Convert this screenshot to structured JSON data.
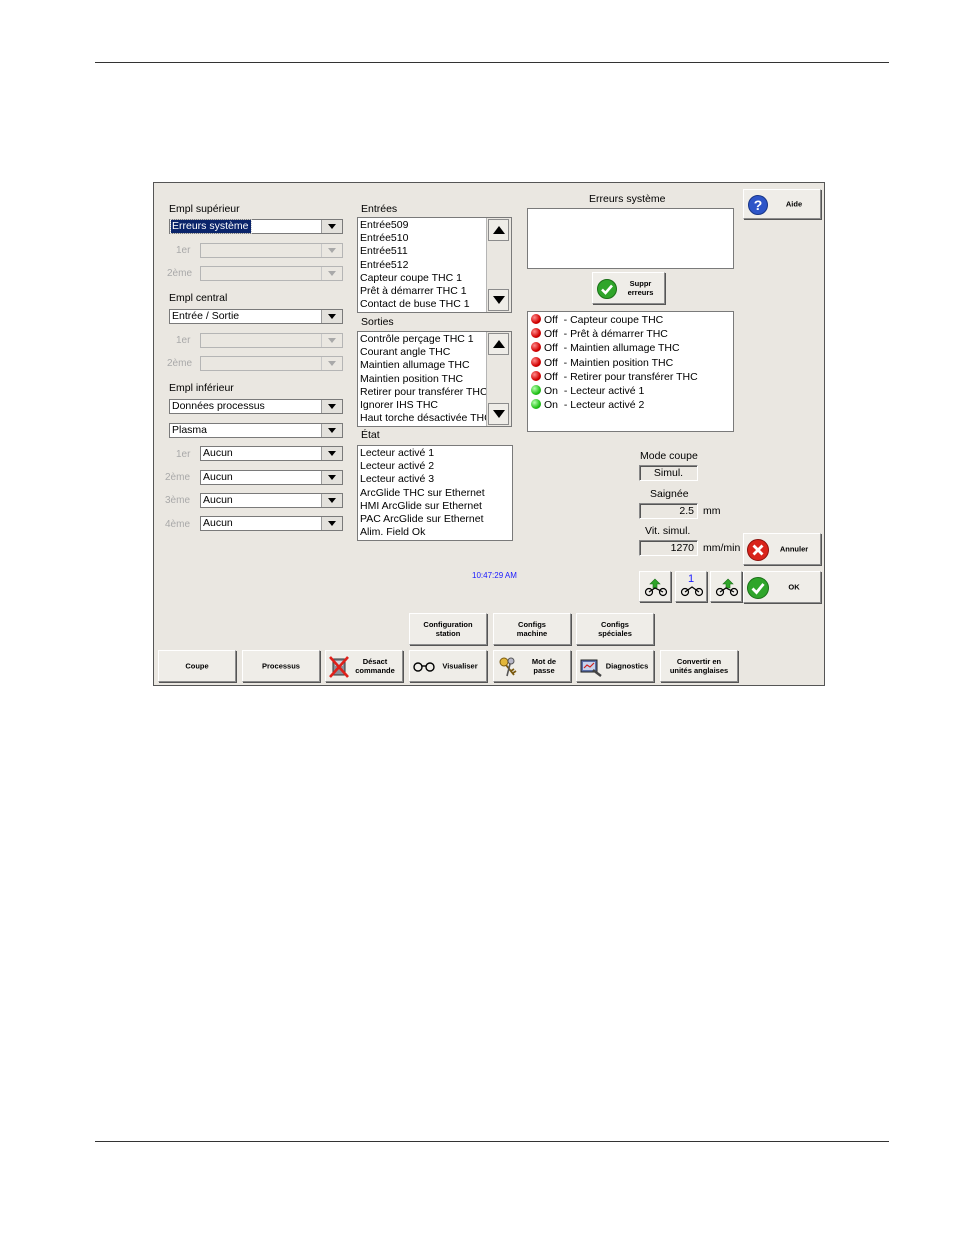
{
  "left": {
    "upper": {
      "title": "Empl supérieur",
      "value": "Erreurs système",
      "slot1_label": "1er",
      "slot2_label": "2ème"
    },
    "central": {
      "title": "Empl central",
      "value": "Entrée / Sortie",
      "slot1_label": "1er",
      "slot2_label": "2ème"
    },
    "lower": {
      "title": "Empl inférieur",
      "value": "Données processus",
      "process": "Plasma",
      "slots": [
        {
          "label": "1er",
          "value": "Aucun"
        },
        {
          "label": "2ème",
          "value": "Aucun"
        },
        {
          "label": "3ème",
          "value": "Aucun"
        },
        {
          "label": "4ème",
          "value": "Aucun"
        }
      ]
    }
  },
  "entrees": {
    "title": "Entrées",
    "items": [
      "Entrée509",
      "Entrée510",
      "Entrée511",
      "Entrée512",
      "Capteur coupe THC 1",
      "Prêt à démarrer THC 1",
      "Contact de buse THC 1"
    ]
  },
  "sorties": {
    "title": "Sorties",
    "items": [
      "Contrôle perçage THC 1",
      "Courant angle THC",
      "Maintien allumage THC",
      "Maintien position THC",
      "Retirer pour transférer THC",
      "Ignorer IHS THC",
      "Haut torche désactivée THC"
    ]
  },
  "etat": {
    "title": "État",
    "items": [
      "Lecteur activé 1",
      "Lecteur activé 2",
      "Lecteur activé 3",
      "ArcGlide THC sur Ethernet",
      "HMI ArcGlide sur Ethernet",
      "PAC ArcGlide sur Ethernet",
      "Alim. Field Ok"
    ]
  },
  "errors": {
    "title": "Erreurs système",
    "clear_button": "Suppr\nerreurs"
  },
  "help_button": "Aide",
  "status": [
    {
      "state": "Off",
      "label": "Capteur coupe THC",
      "color": "red"
    },
    {
      "state": "Off",
      "label": "Prêt à démarrer THC",
      "color": "red"
    },
    {
      "state": "Off",
      "label": "Maintien allumage THC",
      "color": "red"
    },
    {
      "state": "Off",
      "label": "Maintien position THC",
      "color": "red"
    },
    {
      "state": "Off",
      "label": "Retirer pour transférer THC",
      "color": "red"
    },
    {
      "state": "On",
      "label": "Lecteur activé 1",
      "color": "green"
    },
    {
      "state": "On",
      "label": "Lecteur activé 2",
      "color": "green"
    }
  ],
  "mode": {
    "title": "Mode coupe",
    "value": "Simul."
  },
  "kerf": {
    "title": "Saignée",
    "value": "2.5",
    "unit": "mm"
  },
  "speed": {
    "title": "Vit. simul.",
    "value": "1270",
    "unit": "mm/min"
  },
  "time": "10:47:29 AM",
  "cancel_button": "Annuler",
  "ok_button": "OK",
  "stepper_label": "1",
  "top_buttons": [
    "Configuration\nstation",
    "Configs\nmachine",
    "Configs\nspéciales"
  ],
  "bottom_buttons": {
    "coupe": "Coupe",
    "processus": "Processus",
    "desact": "Désact\ncommande",
    "visualiser": "Visualiser",
    "motdepasse": "Mot de\npasse",
    "diagnostics": "Diagnostics",
    "convertir": "Convertir en\nunités anglaises"
  },
  "colors": {
    "panel": "#eae7e1",
    "selection": "#0a246a",
    "time": "#1a1aff"
  }
}
